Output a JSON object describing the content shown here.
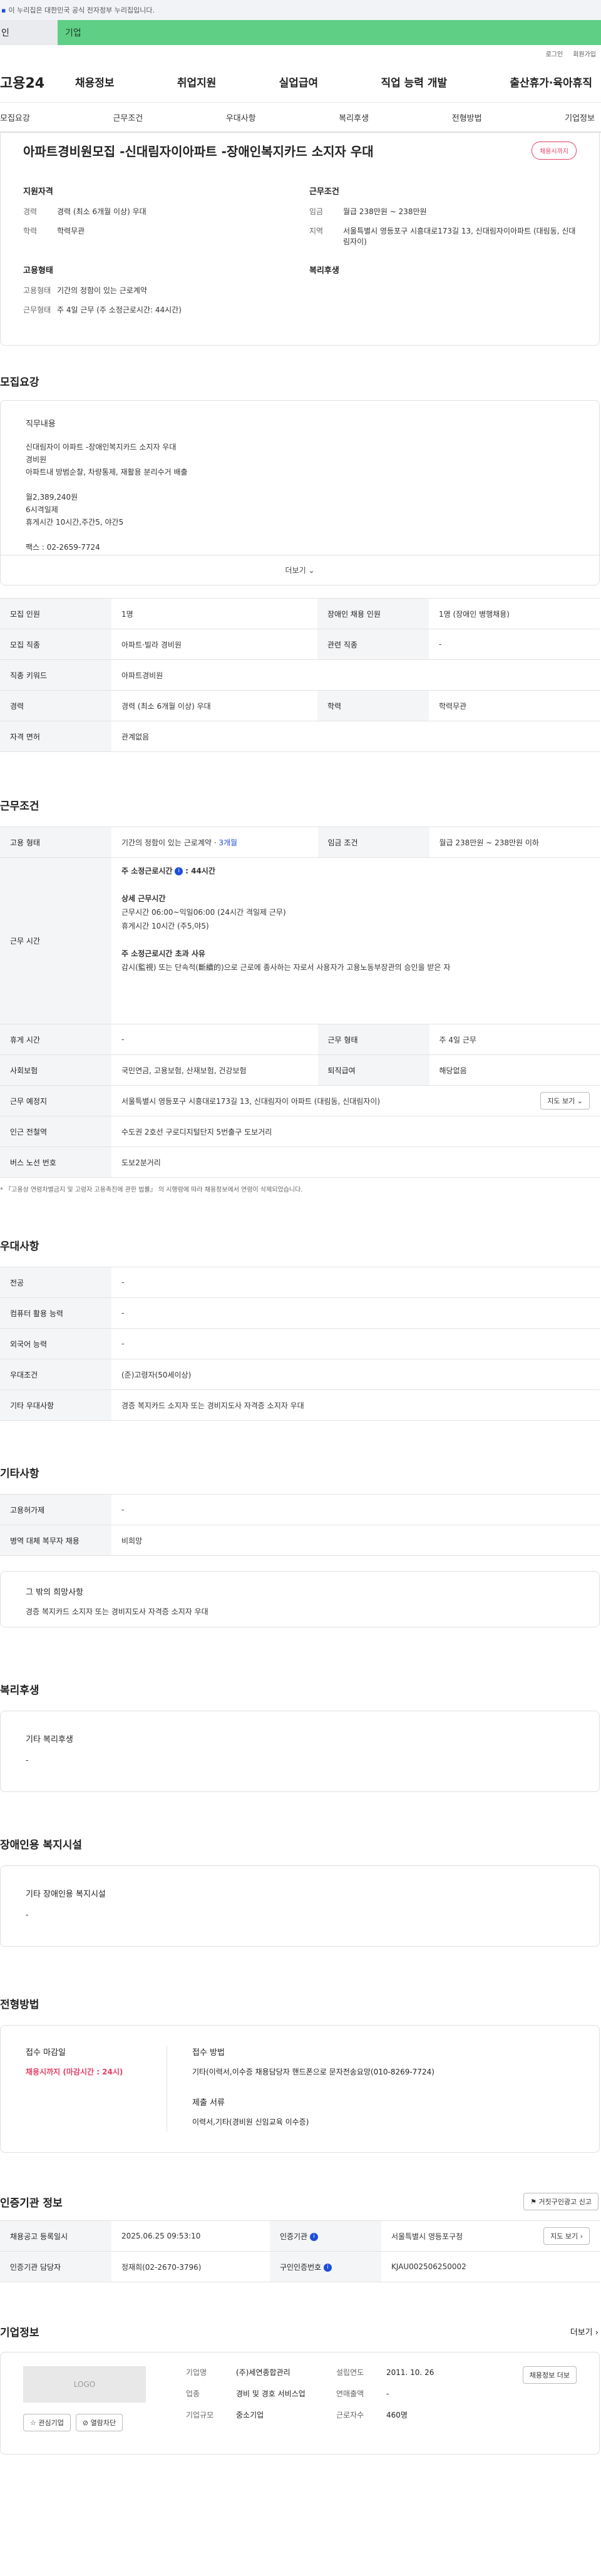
{
  "gov_banner": "이 누리집은 대한민국 공식 전자정부 누리집입니다.",
  "site_tabs": {
    "personal": "인",
    "enterprise": "기업"
  },
  "util": {
    "login": "로그인",
    "signup": "회원가입"
  },
  "gnb": {
    "logo": "고용24",
    "menu": [
      "채용정보",
      "취업지원",
      "실업급여",
      "직업 능력 개발",
      "출산휴가·육아휴직"
    ]
  },
  "subnav": [
    "모집요강",
    "근무조건",
    "우대사항",
    "복리후생",
    "전형방법",
    "기업정보"
  ],
  "title": "아파트경비원모집 -신대림자이아파트 -장애인복지카드 소지자 우대",
  "title_badge": "채용시까지",
  "summary": {
    "applicant": {
      "heading": "지원자격",
      "rows": [
        {
          "k": "경력",
          "v": "경력 (최소 6개월 이상) 우대"
        },
        {
          "k": "학력",
          "v": "학력무관"
        }
      ]
    },
    "conditions": {
      "heading": "근무조건",
      "rows": [
        {
          "k": "임금",
          "v": "월급 238만원 ~ 238만원"
        },
        {
          "k": "지역",
          "v": "서울특별시 영등포구 시흥대로173길 13, 신대림자이아파트 (대림동, 신대림자이)"
        }
      ]
    },
    "employment": {
      "heading": "고용형태",
      "rows": [
        {
          "k": "고용형태",
          "v": "기간의 정함이 있는 근로계약"
        },
        {
          "k": "근무형태",
          "v": "주 4일 근무 (주 소정근로시간: 44시간)"
        }
      ]
    },
    "welfare": {
      "heading": "복리후생"
    }
  },
  "recruit": {
    "heading": "모집요강",
    "job_label": "직무내용",
    "lines": [
      "신대림자이 아파트 -장애인복지카드 소지자 우대",
      "경비원",
      "아파트내 방범순찰, 차량통제, 재활용 분리수거 배출",
      "",
      "월2,389,240원",
      "6시격일제",
      "휴게시간 10시간,주간5, 야간5",
      "",
      "팩스 : 02-2659-7724"
    ],
    "more": "더보기",
    "table": [
      [
        "모집 인원",
        "1명",
        "장애인 채용 인원",
        "1명 (장애인 병행채용)"
      ],
      [
        "모집 직종",
        "아파트·빌라 경비원",
        "관련 직종",
        "-"
      ],
      [
        "직종 키워드",
        "아파트경비원",
        "",
        ""
      ],
      [
        "경력",
        "경력 (최소 6개월 이상) 우대",
        "학력",
        "학력무관"
      ],
      [
        "자격 면허",
        "관계없음",
        "",
        ""
      ]
    ]
  },
  "work": {
    "heading": "근무조건",
    "employ_type_label": "고용 형태",
    "employ_type_value": "기간의 정함이 있는 근로계약 · ",
    "employ_type_period": "3개월",
    "wage_label": "임금 조건",
    "wage_value": "월급 238만원 ~ 238만원 이하",
    "hours_label": "근무 시간",
    "hours": {
      "weekly_label": "주 소정근로시간",
      "weekly_value": ": 44시간",
      "detail_label": "상세 근무시간",
      "detail_1": "근무시간 06:00~익일06:00 (24시간 격일제 근무)",
      "detail_2": "휴게시간 10시간 (주5,야5)",
      "over_label": "주 소정근로시간 초과 사유",
      "over_text": "감시(監視) 또는 단속적(斷續的)으로 근로에 종사하는 자로서 사용자가 고용노동부장관의 승인을 받은 자"
    },
    "rest_label": "휴게 시간",
    "rest_value": "-",
    "form_label": "근무 형태",
    "form_value": "주 4일 근무",
    "insurance_label": "사회보험",
    "insurance_value": "국민연금, 고용보험, 산재보험, 건강보험",
    "retire_label": "퇴직급여",
    "retire_value": "해당없음",
    "place_label": "근무 예정지",
    "place_value": "서울특별시 영등포구 시흥대로173길 13, 신대림자이 아파트 (대림동, 신대림자이)",
    "map_btn": "지도 보기",
    "subway_label": "인근 전철역",
    "subway_value": "수도권 2호선 구로디지털단지 5번출구 도보거리",
    "bus_label": "버스 노선 번호",
    "bus_value": "도보2분거리",
    "note": "* 『고용상 연령차별금지 및 고령자 고용촉진에 관한 법률』 의 시행령에 따라 채용정보에서 연령이 삭제되었습니다."
  },
  "preference": {
    "heading": "우대사항",
    "rows": [
      [
        "전공",
        "-"
      ],
      [
        "컴퓨터 활용 능력",
        "-"
      ],
      [
        "외국어 능력",
        "-"
      ],
      [
        "우대조건",
        "(준)고령자(50세이상)"
      ],
      [
        "기타 우대사항",
        "경증 복지카드 소지자 또는 경비지도사 자격증 소지자 우대"
      ]
    ]
  },
  "etc": {
    "heading": "기타사항",
    "rows": [
      [
        "고용허가제",
        "-"
      ],
      [
        "병역 대체 복무자 채용",
        "비희망"
      ]
    ],
    "wish_label": "그 밖의 희망사항",
    "wish_text": "경증 복지카드 소지자 또는 경비지도사 자격증 소지자 우대"
  },
  "benefits": {
    "heading": "복리후생",
    "label": "기타 복리후생",
    "value": "-"
  },
  "disability": {
    "heading": "장애인용 복지시설",
    "label": "기타 장애인용 복지시설",
    "value": "-"
  },
  "screening": {
    "heading": "전형방법",
    "deadline_label": "접수 마감일",
    "deadline_value": "채용시까지 (마감시간 : 24시)",
    "method_label": "접수 방법",
    "method_value": "기타(이력서,이수증 채용담당자 핸드폰으로 문자전송요망(010-8269-7724)",
    "docs_label": "제출 서류",
    "docs_value": "이력서,기타(경비원 신임교육 이수증)"
  },
  "cert": {
    "heading": "인증기관 정보",
    "report_btn": "거짓구인광고 신고",
    "rows": [
      [
        "채용공고 등록일시",
        "2025.06.25 09:53:10",
        "인증기관",
        "서울특별시 영등포구청"
      ],
      [
        "인증기관 담당자",
        "정재희(02-2670-3796)",
        "구인인증번호",
        "KJAU002506250002"
      ]
    ],
    "map_btn": "지도 보기"
  },
  "company": {
    "heading": "기업정보",
    "more": "더보기",
    "logo": "LOGO",
    "fav_btn": "관심기업",
    "block_btn": "열람차단",
    "name_label": "기업명",
    "name_value": "(주)세연종합관리",
    "industry_label": "업종",
    "industry_value": "경비 및 경호 서비스업",
    "size_label": "기업규모",
    "size_value": "중소기업",
    "founded_label": "설립연도",
    "founded_value": "2011. 10. 26",
    "revenue_label": "연매출액",
    "revenue_value": "-",
    "staff_label": "근로자수",
    "staff_value": "460명",
    "jobs_btn": "채용정보 더보"
  }
}
